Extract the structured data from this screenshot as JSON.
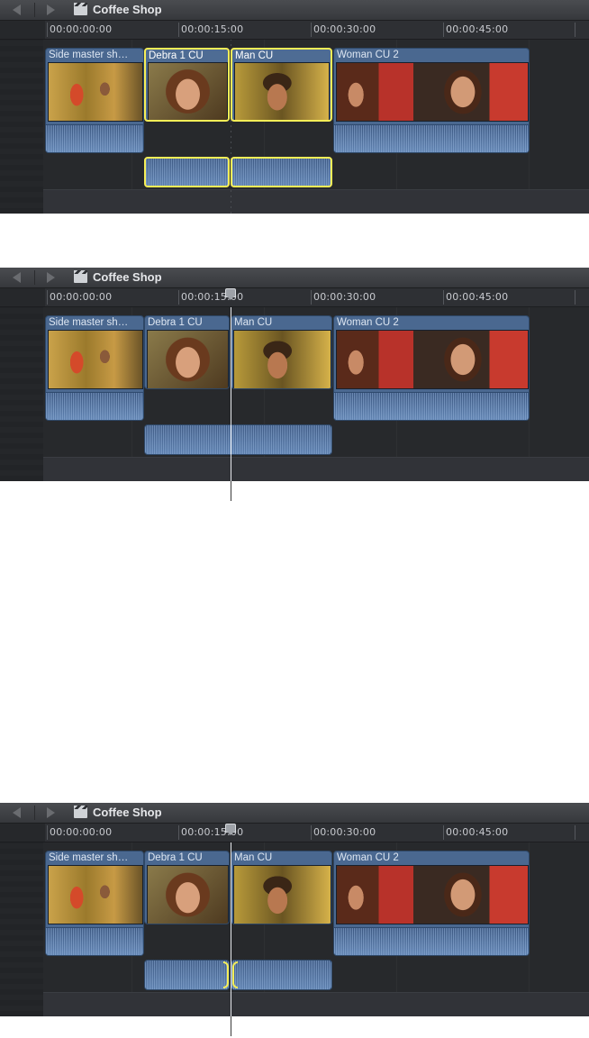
{
  "screenshot": "Final Cut Pro timeline — connected audio clips, three states",
  "project_title": "Coffee Shop",
  "ruler_ticks": [
    "00:00:00:00",
    "00:00:15:00",
    "00:00:30:00",
    "00:00:45:00"
  ],
  "clips": {
    "side_master": "Side master sh…",
    "debra": "Debra 1 CU",
    "man": "Man CU",
    "woman": "Woman CU 2"
  },
  "colors": {
    "selection": "#f6ee57",
    "clip_blue": "#4a6890",
    "timeline_bg": "#27292c"
  },
  "icons": [
    "back-arrow-icon",
    "forward-arrow-icon",
    "clapper-icon",
    "playhead-icon"
  ]
}
